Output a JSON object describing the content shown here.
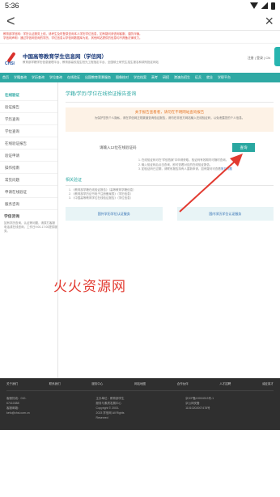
{
  "status_bar": {
    "time": "5:36"
  },
  "appbar": {
    "back_icon": "<",
    "close_icon": "×"
  },
  "notice": {
    "lines": [
      "教育部学信网：学历认证服务上线，请考生及时登录查询本人学历学位信息，如有疑问请咨询客服，谨防诈骗。",
      "学信网声明：通过学信网查询的学历、学位信息以学信网数据库为准，其他网站提供的信息均不具备法律效力。"
    ]
  },
  "header": {
    "logo_text": "CHSI",
    "site_title": "中国高等教育学生信息网（学信网）",
    "site_subtitle": "教育部学籍学历信息管理平台、教育部高校招生阳光工程指定平台、全国硕士研究生招生报名和调剂指定网站",
    "login_links": "注册 | 登录 | CN"
  },
  "nav": {
    "items": [
      "首页",
      "学籍查询",
      "学历查询",
      "学位查询",
      "在线验证",
      "出国教育背景服务",
      "图像校对",
      "学信档案",
      "高考",
      "研招",
      "港澳台招生",
      "征兵",
      "就业",
      "学职平台"
    ]
  },
  "sidebar": {
    "items": [
      "在线验证",
      "验证报告",
      "学历查询",
      "学位查询",
      "在线验证报告",
      "验证申请",
      "操作指南",
      "常见问题",
      "申请在线验证",
      "服务咨询"
    ],
    "help_title": "学信咨询",
    "help_text": "如有学历查询、认证等问题，请拨打客服电话或在线咨询，工作日9:00-17:00提供服务。"
  },
  "main": {
    "title": "学籍/学历/学位在线验证报告查询",
    "warning_title": "关于报告查看者，请勿在不明网站查询报告",
    "warning_desc": "为保护您的个人隐私，请在学信网正规渠道查询验证报告，请勿在非官方网站输入在线验证码，以免泄露您的个人信息。",
    "code_label": "请输入12位在线验证码",
    "query_button": "查询",
    "help_lines": [
      "1. 在线验证码可在“学信档案”中申请获取，验证码有效期内可随时查询。",
      "2. 输入验证码后点击查询，即可查看对应的在线验证报告。",
      "3. 如验证码已过期，请联系报告持有人重新申请。如有疑问可查看"
    ],
    "help_link": "常见问题",
    "related_title": "相关验证",
    "related_list": [
      "1. 《教育部学籍在线验证报告》（高等教育学籍信息）",
      "2. 《教育部学历证书电子注册备案表》（学历信息）",
      "3. 《中国高等教育学位在线验证报告》（学位信息）"
    ],
    "btn_left": "国外学历学位认证服务",
    "btn_right": "国内学历学位认证服务"
  },
  "watermark": "火火资源网",
  "footer": {
    "nav": [
      "关于我们",
      "联系我们",
      "服务中心",
      "网站地图",
      "合作伙伴",
      "人才招聘",
      "诚征英才"
    ],
    "col1": [
      "客服热线：010-67410388",
      "客服邮箱：kefu@chsi.com.cn"
    ],
    "col2": [
      "主办单位：教育部学生服务与素质发展中心",
      "Copyright © 2003-2023 学信网 All Rights Reserved"
    ],
    "col3": [
      "京ICP备19004913号-1",
      "京公网安备11010202007478号"
    ]
  }
}
